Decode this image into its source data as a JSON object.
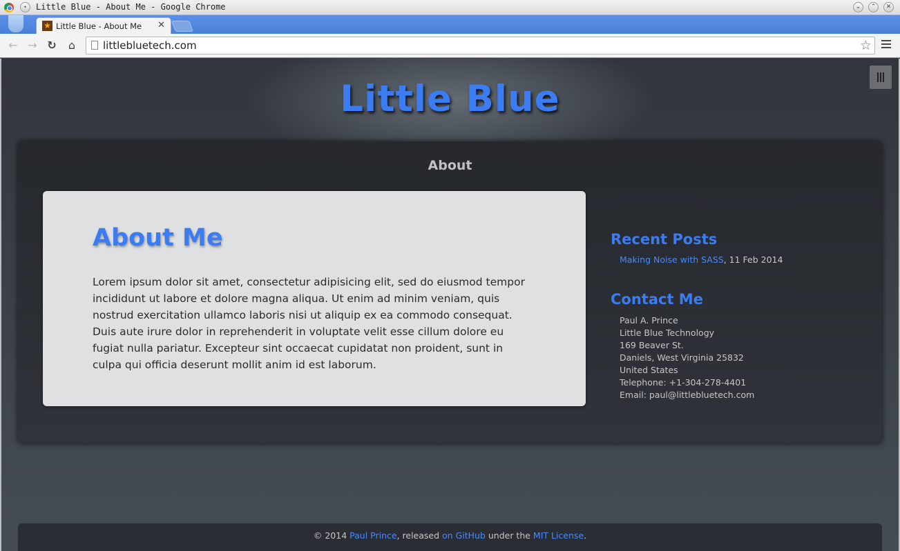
{
  "window": {
    "title": "Little Blue - About Me - Google Chrome"
  },
  "tab": {
    "title": "Little Blue - About Me",
    "close_glyph": "✕"
  },
  "toolbar": {
    "url": "littlebluetech.com"
  },
  "site": {
    "title": "Little Blue"
  },
  "section": {
    "title": "About"
  },
  "article": {
    "title": "About Me",
    "body": "Lorem ipsum dolor sit amet, consectetur adipisicing elit, sed do eiusmod tempor incididunt ut labore et dolore magna aliqua. Ut enim ad minim veniam, quis nostrud exercitation ullamco laboris nisi ut aliquip ex ea commodo consequat. Duis aute irure dolor in reprehenderit in voluptate velit esse cillum dolore eu fugiat nulla pariatur. Excepteur sint occaecat cupidatat non proident, sunt in culpa qui officia deserunt mollit anim id est laborum."
  },
  "sidebar": {
    "recent_heading": "Recent Posts",
    "posts": [
      {
        "title": "Making Noise with SASS",
        "date": ", 11 Feb 2014"
      }
    ],
    "contact_heading": "Contact Me",
    "contact_lines": [
      "Paul A. Prince",
      "Little Blue Technology",
      "169 Beaver St.",
      "Daniels, West Virginia 25832",
      "United States",
      "Telephone: +1-304-278-4401",
      "Email: paul@littlebluetech.com"
    ]
  },
  "footer": {
    "copyright": "© 2014 ",
    "author_link": "Paul Prince",
    "released_text": ", released ",
    "github_link": "on GitHub",
    "under_text": " under the ",
    "license_link": "MIT License",
    "end_text": "."
  },
  "colors": {
    "accent": "#3b7cf0",
    "link": "#4b8af5",
    "panel": "#2a2d33",
    "article_bg": "#dfe0e1"
  }
}
